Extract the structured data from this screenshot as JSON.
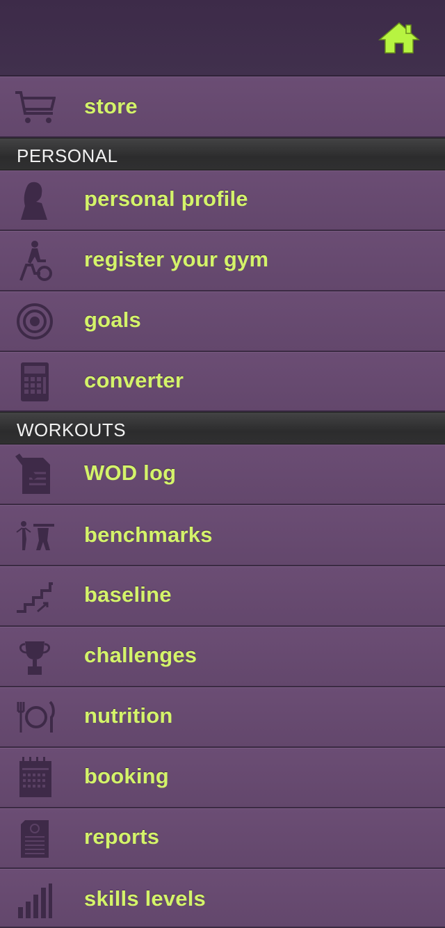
{
  "header": {
    "home_icon": "home-icon",
    "accent": "#b7f441"
  },
  "top_items": [
    {
      "label": "store",
      "icon": "cart-icon"
    }
  ],
  "sections": [
    {
      "title": "PERSONAL",
      "items": [
        {
          "label": "personal profile",
          "icon": "profile-icon"
        },
        {
          "label": "register your gym",
          "icon": "bike-icon"
        },
        {
          "label": "goals",
          "icon": "target-icon"
        },
        {
          "label": "converter",
          "icon": "calculator-icon"
        }
      ]
    },
    {
      "title": "WORKOUTS",
      "items": [
        {
          "label": "WOD log",
          "icon": "log-icon"
        },
        {
          "label": "benchmarks",
          "icon": "weightlifter-icon"
        },
        {
          "label": "baseline",
          "icon": "stairs-icon"
        },
        {
          "label": "challenges",
          "icon": "trophy-icon"
        },
        {
          "label": "nutrition",
          "icon": "plate-icon"
        },
        {
          "label": "booking",
          "icon": "calendar-icon"
        },
        {
          "label": "reports",
          "icon": "report-icon"
        },
        {
          "label": "skills levels",
          "icon": "bars-icon"
        }
      ]
    }
  ],
  "colors": {
    "label": "#d4f36a",
    "row_bg": "#66496f",
    "header_bg": "#3d2b49",
    "icon": "#3e2a48"
  }
}
